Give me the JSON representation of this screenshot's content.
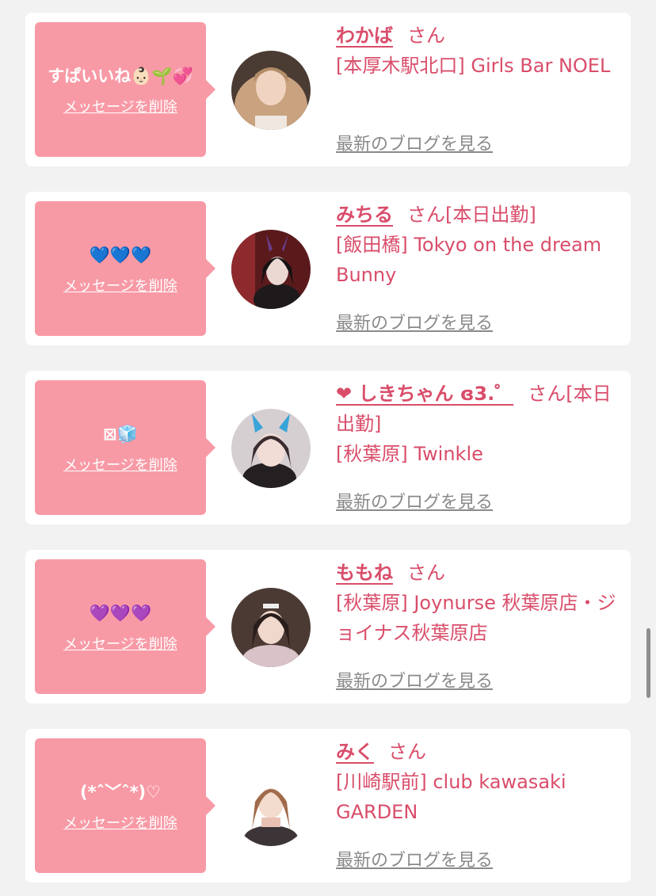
{
  "delete_label": "メッセージを削除",
  "blog_label": "最新のブログを見る",
  "cards": [
    {
      "message": "すぱいいね👶🏻🌱💞",
      "name": "わかば",
      "suffix": "さん",
      "shop": "[本厚木駅北口] Girls Bar NOEL"
    },
    {
      "message": "💙💙💙",
      "name": "みちる",
      "suffix": "さん[本日出勤]",
      "shop": "[飯田橋] Tokyo on the dream Bunny"
    },
    {
      "message": "⊠🧊",
      "name": "❤ しきちゃん ɞ3.゜",
      "suffix": "さん[本日出勤]",
      "shop": "[秋葉原] Twinkle"
    },
    {
      "message": "💜💜💜",
      "name": "ももね",
      "suffix": "さん",
      "shop": "[秋葉原] Joynurse 秋葉原店・ジョイナス秋葉原店"
    },
    {
      "message": "(*ˆ﹀ˆ*)♡",
      "name": "みく",
      "suffix": "さん",
      "shop": "[川崎駅前] club kawasaki GARDEN"
    }
  ]
}
